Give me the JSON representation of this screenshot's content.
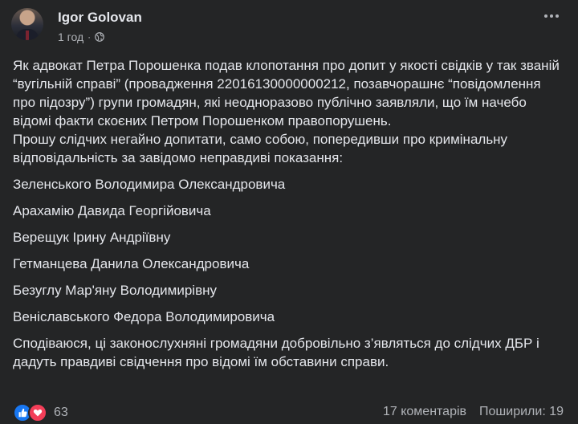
{
  "post": {
    "author": "Igor Golovan",
    "time": "1 год",
    "separator": "·",
    "privacy_icon": "globe-icon",
    "paragraphs": [
      "Як адвокат Петра Порошенка подав клопотання про допит у якості свідків у так званій “вугільній справі” (провадження 22016130000000212, позавчорашнє “повідомлення про підозру”) групи громадян, які неодноразово публічно заявляли, що їм начебо відомі факти скоєних Петром Порошенком правопорушень.",
      "Прошу слідчих негайно допитати, само собою, попередивши про кримінальну відповідальність за завідомо неправдиві показання:"
    ],
    "witnesses": [
      "Зеленського Володимира Олександровича",
      "Арахамію Давида Георгійовича",
      "Верещук Ірину Андріївну",
      "Гетманцева Данила Олександровича",
      "Безуглу Мар'яну Володимирівну",
      "Веніславського Федора Володимировича"
    ],
    "closing": "Сподіваюся, ці законослухняні громадяни  добровільно з’являться до слідчих ДБР і дадуть правдиві свідчення про відомі їм обставини справи."
  },
  "footer": {
    "reaction_icons": [
      "like-icon",
      "love-icon"
    ],
    "reaction_count": "63",
    "comments": "17 коментарів",
    "shares": "Поширили: 19"
  },
  "colors": {
    "background": "#242526",
    "text": "#e4e6eb",
    "secondary_text": "#b0b3b8",
    "like": "#1877f2",
    "love": "#f33e58"
  }
}
